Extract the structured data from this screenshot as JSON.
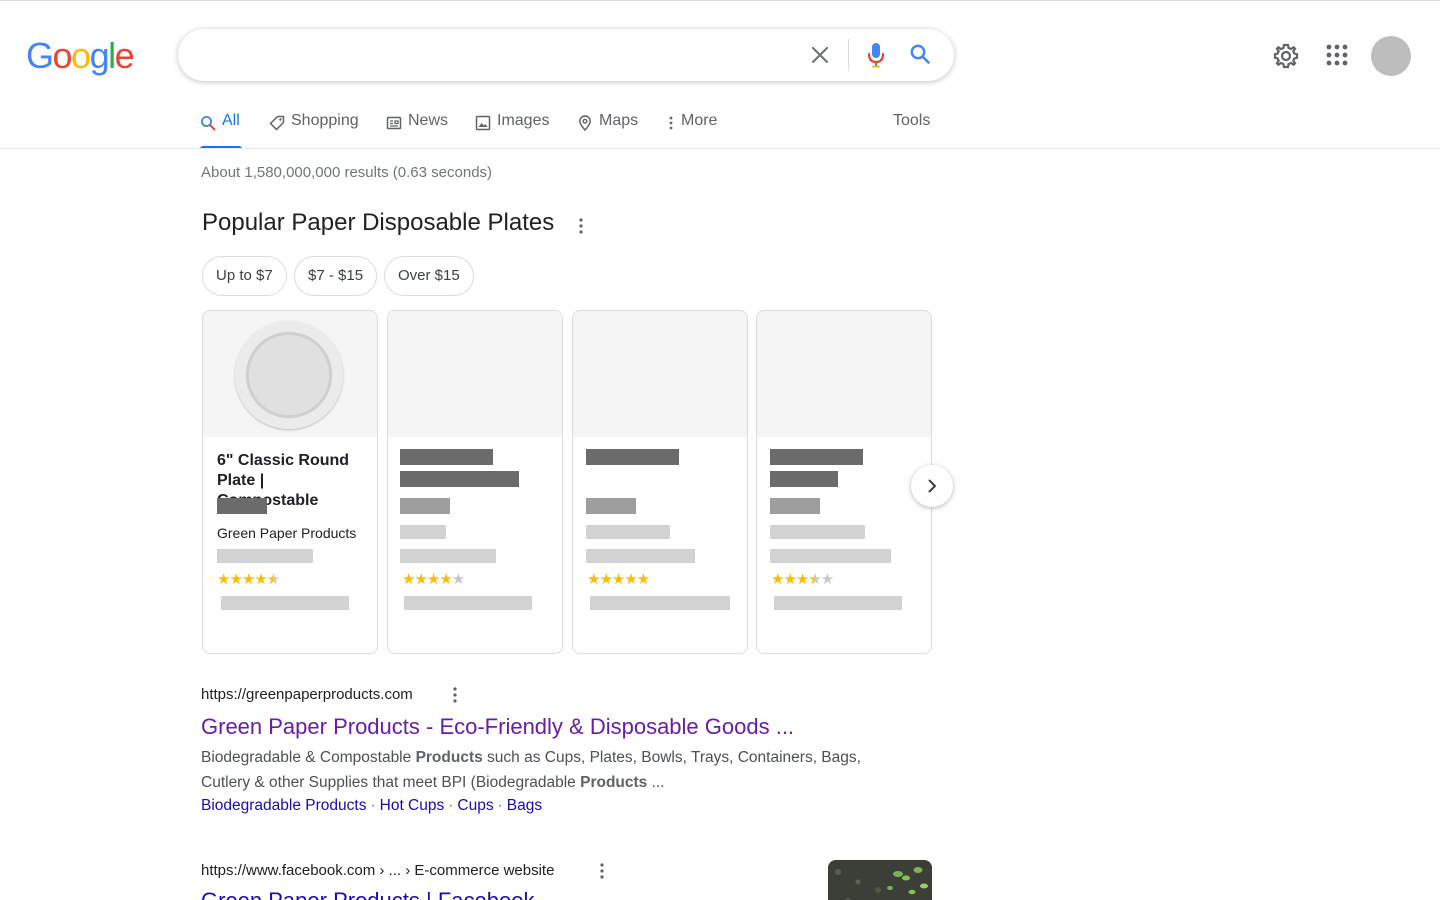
{
  "header": {
    "logo_letters": [
      "G",
      "o",
      "o",
      "g",
      "l",
      "e"
    ],
    "search_value": "",
    "icons": [
      "close-icon",
      "mic-icon",
      "search-icon",
      "settings-gear-icon",
      "apps-grid-icon",
      "avatar"
    ]
  },
  "tabs": [
    {
      "label": "All",
      "icon": "search-icon",
      "active": true
    },
    {
      "label": "Shopping",
      "icon": "tag-icon"
    },
    {
      "label": "News",
      "icon": "newspaper-icon"
    },
    {
      "label": "Images",
      "icon": "image-icon"
    },
    {
      "label": "Maps",
      "icon": "map-pin-icon"
    },
    {
      "label": "More",
      "icon": "more-vert-icon"
    }
  ],
  "tools_label": "Tools",
  "results_stats": "About 1,580,000,000 results (0.63 seconds)",
  "shopping": {
    "title": "Popular Paper Disposable Plates",
    "chips": [
      "Up to $7",
      "$7 - $15",
      "Over $15"
    ],
    "cards": [
      {
        "title": "6\" Classic Round Plate | Compostable",
        "merchant": "Green Paper Products",
        "rating": 4.5,
        "redacted": false
      },
      {
        "rating": 4,
        "redacted": true
      },
      {
        "rating": 5,
        "redacted": true
      },
      {
        "rating": 3.5,
        "redacted": true
      }
    ]
  },
  "results": [
    {
      "url": "https://greenpaperproducts.com",
      "title": "Green Paper Products - Eco-Friendly & Disposable Goods ...",
      "snippet_parts": [
        {
          "text": "Biodegradable & Compostable ",
          "bold": false
        },
        {
          "text": "Products",
          "bold": true
        },
        {
          "text": " such as Cups, Plates, Bowls, Trays, Containers, Bags, Cutlery & other Supplies that meet BPI (Biodegradable ",
          "bold": false
        },
        {
          "text": "Products",
          "bold": true
        },
        {
          "text": " ...",
          "bold": false
        }
      ],
      "sitelinks": [
        "Biodegradable Products",
        "Hot Cups",
        "Cups",
        "Bags"
      ]
    },
    {
      "url": "https://www.facebook.com › ... › E-commerce website",
      "title": "Green Paper Products | Facebook"
    }
  ],
  "colors": {
    "link_visited": "#681da8",
    "link": "#1a0dab",
    "accent": "#1a73e8",
    "star": "#fbbc04"
  }
}
